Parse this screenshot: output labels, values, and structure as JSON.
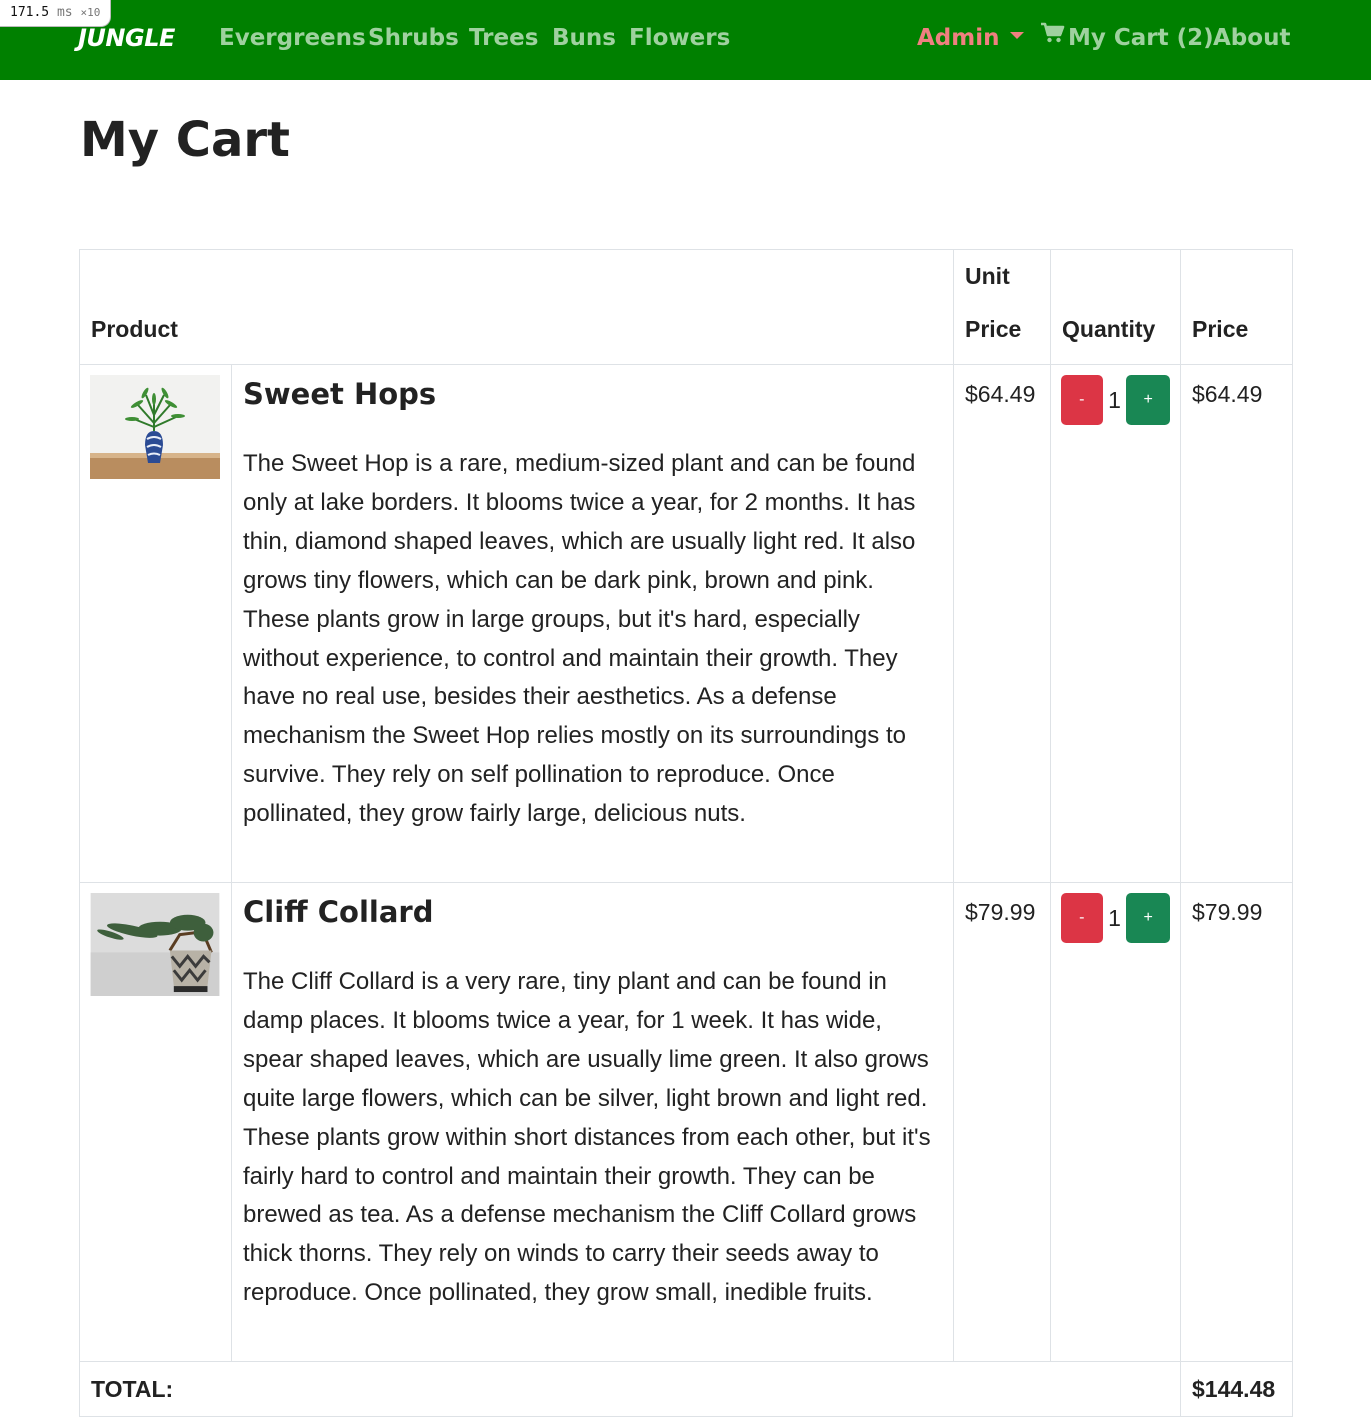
{
  "perf": {
    "value": "171.5",
    "unit": "ms",
    "multiplier": "×10"
  },
  "nav": {
    "brand": "JUNGLE",
    "links": [
      "Evergreens",
      "Shrubs",
      "Trees",
      "Buns",
      "Flowers"
    ],
    "admin": "Admin",
    "cart": "My Cart (2)",
    "about": "About"
  },
  "page": {
    "title": "My Cart"
  },
  "table": {
    "headers": {
      "product": "Product",
      "unit_price": "Unit Price",
      "quantity": "Quantity",
      "price": "Price"
    },
    "items": [
      {
        "name": "Sweet Hops",
        "description": "The Sweet Hop is a rare, medium-sized plant and can be found only at lake borders. It blooms twice a year, for 2 months. It has thin, diamond shaped leaves, which are usually light red. It also grows tiny flowers, which can be dark pink, brown and pink. These plants grow in large groups, but it's hard, especially without experience, to control and maintain their growth. They have no real use, besides their aesthetics. As a defense mechanism the Sweet Hop relies mostly on its surroundings to survive. They rely on self pollination to reproduce. Once pollinated, they grow fairly large, delicious nuts.",
        "unit_price": "$64.49",
        "quantity": "1",
        "price": "$64.49"
      },
      {
        "name": "Cliff Collard",
        "description": "The Cliff Collard is a very rare, tiny plant and can be found in damp places. It blooms twice a year, for 1 week. It has wide, spear shaped leaves, which are usually lime green. It also grows quite large flowers, which can be silver, light brown and light red. These plants grow within short distances from each other, but it's fairly hard to control and maintain their growth. They can be brewed as tea. As a defense mechanism the Cliff Collard grows thick thorns. They rely on winds to carry their seeds away to reproduce. Once pollinated, they grow small, inedible fruits.",
        "unit_price": "$79.99",
        "quantity": "1",
        "price": "$79.99"
      }
    ],
    "buttons": {
      "minus": "-",
      "plus": "+"
    },
    "total_label": "TOTAL:",
    "total_value": "$144.48"
  },
  "colors": {
    "navbar": "#008000",
    "nav_link": "#9fd19f",
    "admin": "#f08080",
    "minus_button": "#dc3545",
    "plus_button": "#198754"
  },
  "icons": {
    "cart": "shopping-cart-icon",
    "admin_caret": "caret-down-icon"
  }
}
